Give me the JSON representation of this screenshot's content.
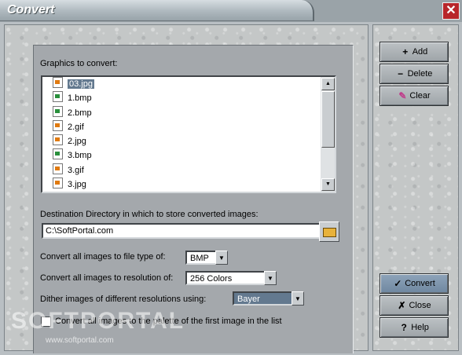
{
  "window": {
    "title": "Convert",
    "close_icon": "close-icon"
  },
  "graphics": {
    "label": "Graphics to convert:",
    "files": [
      {
        "name": "03.jpg",
        "type": "jpg",
        "selected": true
      },
      {
        "name": "1.bmp",
        "type": "bmp"
      },
      {
        "name": "2.bmp",
        "type": "bmp"
      },
      {
        "name": "2.gif",
        "type": "gif"
      },
      {
        "name": "2.jpg",
        "type": "jpg"
      },
      {
        "name": "3.bmp",
        "type": "bmp"
      },
      {
        "name": "3.gif",
        "type": "gif"
      },
      {
        "name": "3.jpg",
        "type": "jpg"
      }
    ]
  },
  "destination": {
    "label": "Destination Directory in which to store converted images:",
    "value": "C:\\SoftPortal.com"
  },
  "options": {
    "file_type_label": "Convert all images to file type of:",
    "file_type_value": "BMP",
    "resolution_label": "Convert all images to resolution of:",
    "resolution_value": "256 Colors",
    "dither_label": "Dither images of different resolutions using:",
    "dither_value": "Bayer",
    "palette_label": "Convert all images to the palette of the first image in the list"
  },
  "buttons": {
    "add": "Add",
    "delete": "Delete",
    "clear": "Clear",
    "convert": "Convert",
    "close": "Close",
    "help": "Help"
  },
  "watermark": {
    "text": "SOFTPORTAL",
    "url": "www.softportal.com"
  },
  "colors": {
    "selection": "#63798f",
    "primary_button": "#7f96ad",
    "close_button": "#b8262a"
  }
}
